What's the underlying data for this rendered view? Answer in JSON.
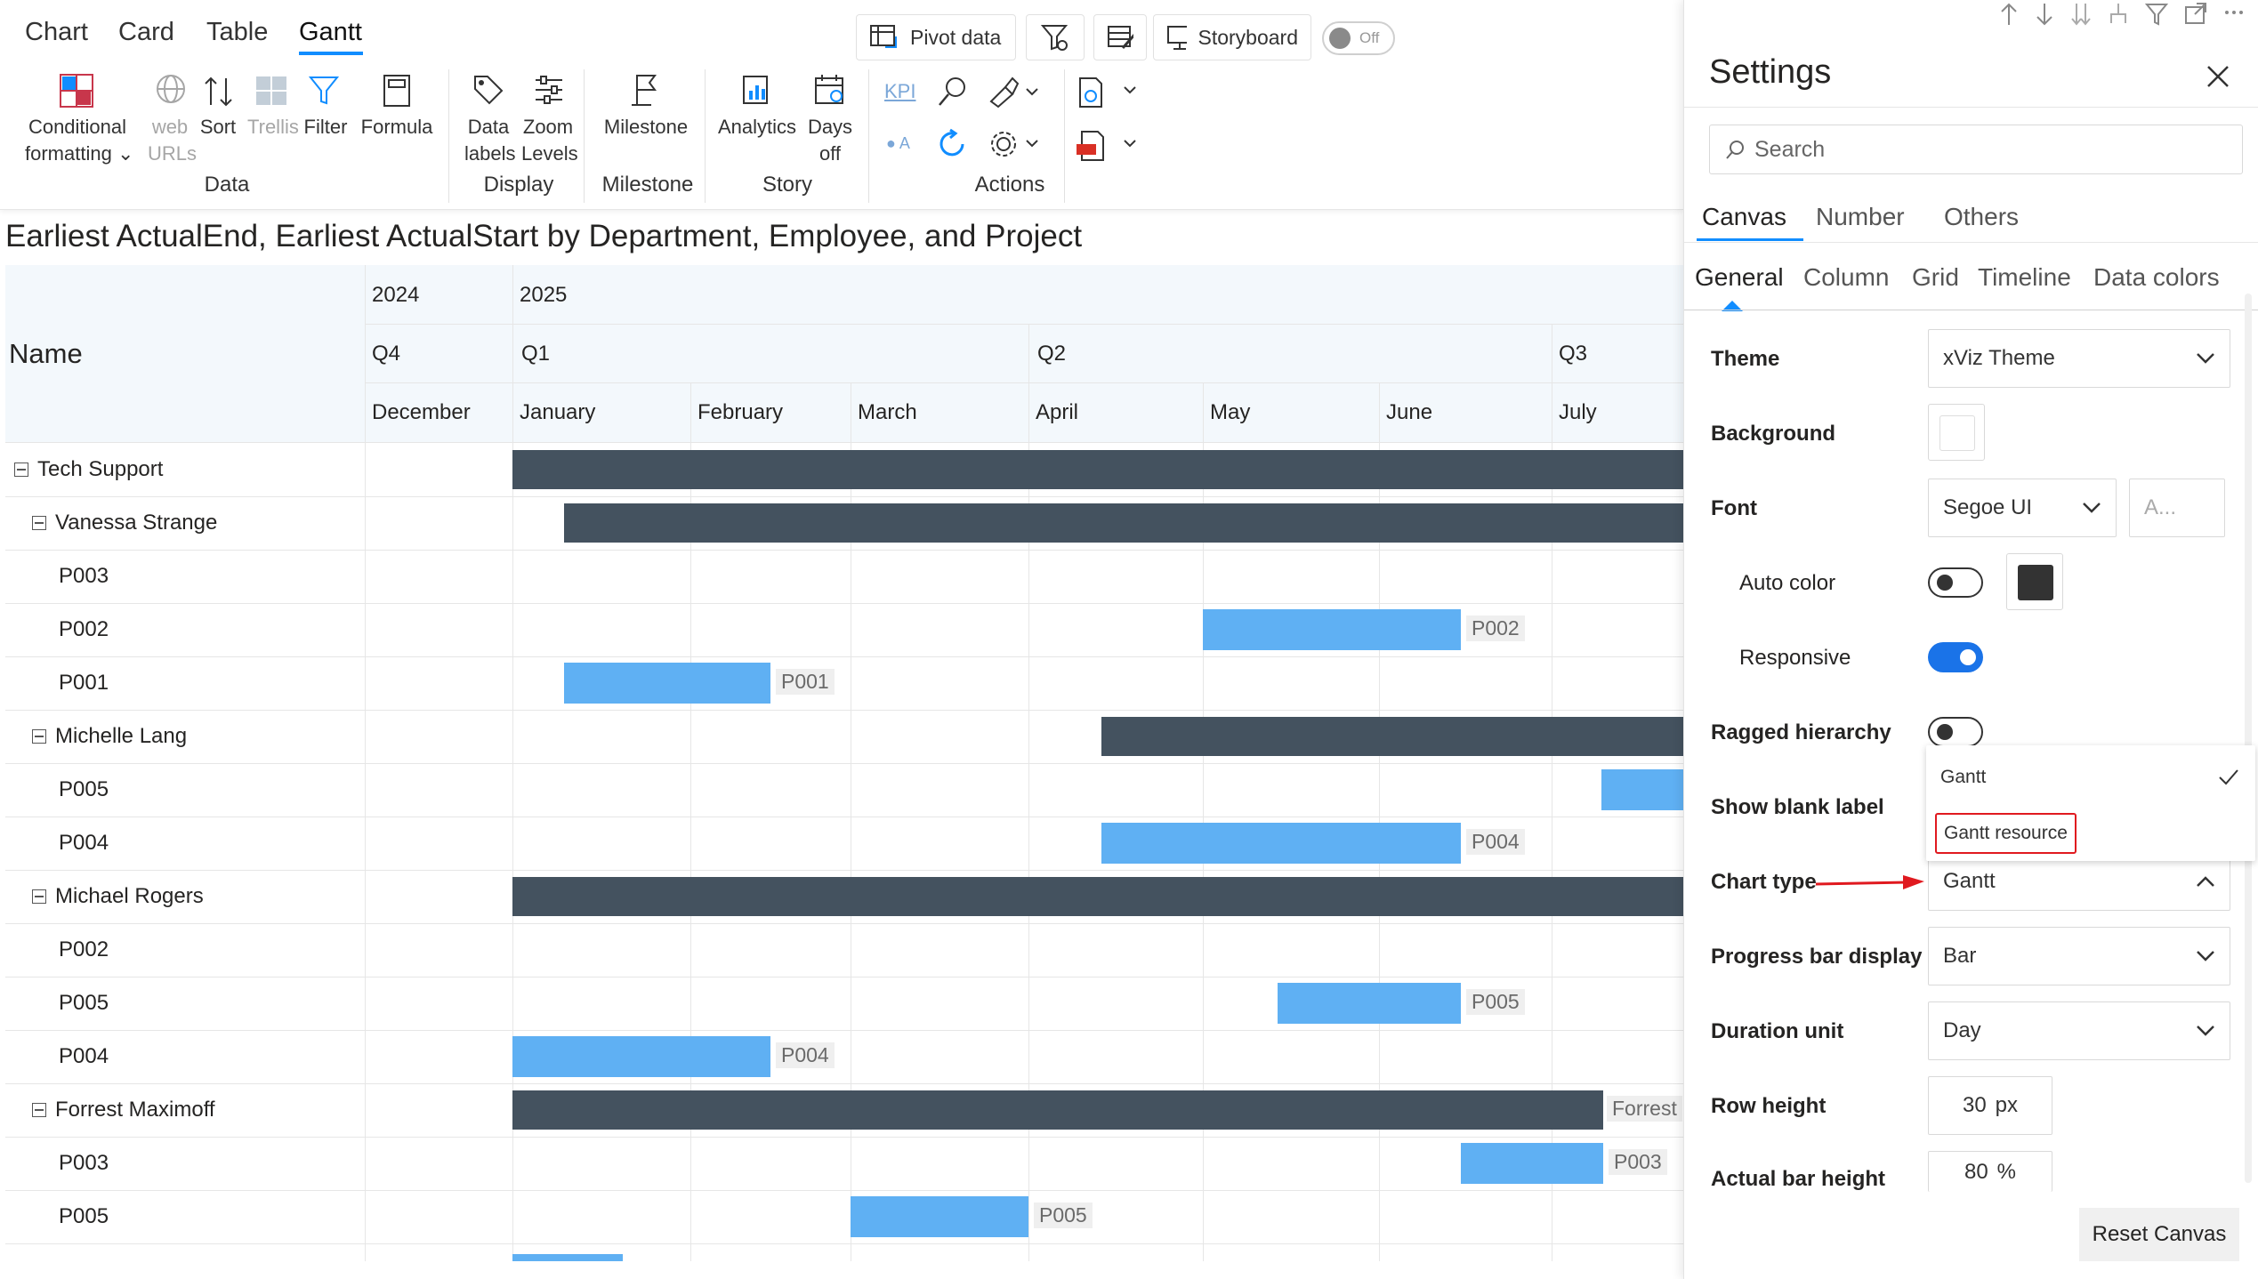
{
  "ribbon": {
    "tabs": [
      "Chart",
      "Card",
      "Table",
      "Gantt"
    ],
    "active_tab": "Gantt",
    "top_buttons": {
      "pivot": "Pivot data",
      "storyboard": "Storyboard",
      "toggle_state": "Off"
    },
    "groups": {
      "data": {
        "label": "Data",
        "items": [
          "Conditional",
          "formatting",
          "web",
          "URLs",
          "Sort",
          "Trellis",
          "Filter",
          "Formula"
        ]
      },
      "display": {
        "label": "Display",
        "items": [
          "Data",
          "labels",
          "Zoom",
          "Levels"
        ]
      },
      "milestone": {
        "label": "Milestone",
        "items": [
          "Milestone"
        ]
      },
      "story": {
        "label": "Story",
        "items": [
          "Analytics",
          "Days",
          "off"
        ]
      },
      "actions": {
        "label": "Actions",
        "kpi": "KPI",
        "oa": "A"
      }
    }
  },
  "chart": {
    "title": "Earliest ActualEnd, Earliest ActualStart by Department, Employee, and Project",
    "name_header": "Name",
    "years": [
      "2024",
      "2025"
    ],
    "quarters": [
      "Q4",
      "Q1",
      "Q2",
      "Q3"
    ],
    "months": [
      "December",
      "January",
      "February",
      "March",
      "April",
      "May",
      "June",
      "July"
    ],
    "rows": [
      {
        "label": "Tech Support",
        "level": 0,
        "expander": true,
        "bar": "group"
      },
      {
        "label": "Vanessa Strange",
        "level": 1,
        "expander": true,
        "bar": "group"
      },
      {
        "label": "P003",
        "level": 2,
        "expander": false,
        "bar": "none"
      },
      {
        "label": "P002",
        "level": 2,
        "expander": false,
        "bar": "task",
        "bar_label": "P002"
      },
      {
        "label": "P001",
        "level": 2,
        "expander": false,
        "bar": "task",
        "bar_label": "P001"
      },
      {
        "label": "Michelle Lang",
        "level": 1,
        "expander": true,
        "bar": "group"
      },
      {
        "label": "P005",
        "level": 2,
        "expander": false,
        "bar": "task"
      },
      {
        "label": "P004",
        "level": 2,
        "expander": false,
        "bar": "task",
        "bar_label": "P004"
      },
      {
        "label": "Michael Rogers",
        "level": 1,
        "expander": true,
        "bar": "group"
      },
      {
        "label": "P002",
        "level": 2,
        "expander": false,
        "bar": "none"
      },
      {
        "label": "P005",
        "level": 2,
        "expander": false,
        "bar": "task",
        "bar_label": "P005"
      },
      {
        "label": "P004",
        "level": 2,
        "expander": false,
        "bar": "task",
        "bar_label": "P004"
      },
      {
        "label": "Forrest Maximoff",
        "level": 1,
        "expander": true,
        "bar": "group",
        "bar_label": "Forrest"
      },
      {
        "label": "P003",
        "level": 2,
        "expander": false,
        "bar": "task",
        "bar_label": "P003"
      },
      {
        "label": "P005",
        "level": 2,
        "expander": false,
        "bar": "task",
        "bar_label": "P005"
      }
    ],
    "colors": {
      "group_bar": "#44525f",
      "task_bar": "#5fb0f3",
      "header_bg": "#f3f8fc"
    }
  },
  "settings": {
    "title": "Settings",
    "search_placeholder": "Search",
    "main_tabs": [
      "Canvas",
      "Number",
      "Others"
    ],
    "sub_tabs": [
      "General",
      "Column",
      "Grid",
      "Timeline",
      "Data colors"
    ],
    "fields": {
      "theme": {
        "label": "Theme",
        "value": "xViz Theme"
      },
      "background": {
        "label": "Background"
      },
      "font": {
        "label": "Font",
        "value": "Segoe UI",
        "size_placeholder": "A..."
      },
      "auto_color": {
        "label": "Auto color",
        "on": false
      },
      "responsive": {
        "label": "Responsive",
        "on": true
      },
      "ragged": {
        "label": "Ragged hierarchy",
        "on": false
      },
      "blank_label": {
        "label": "Show blank label"
      },
      "chart_type": {
        "label": "Chart type",
        "value": "Gantt",
        "options": [
          "Gantt",
          "Gantt resource"
        ]
      },
      "progress": {
        "label": "Progress bar display",
        "value": "Bar"
      },
      "duration": {
        "label": "Duration unit",
        "value": "Day"
      },
      "row_height": {
        "label": "Row height",
        "value": "30",
        "unit": "px"
      },
      "actual_bar": {
        "label": "Actual bar height",
        "value": "80",
        "unit": "%"
      }
    },
    "reset_label": "Reset Canvas",
    "accent": "#1a73e8",
    "highlight": "#e0191f"
  }
}
